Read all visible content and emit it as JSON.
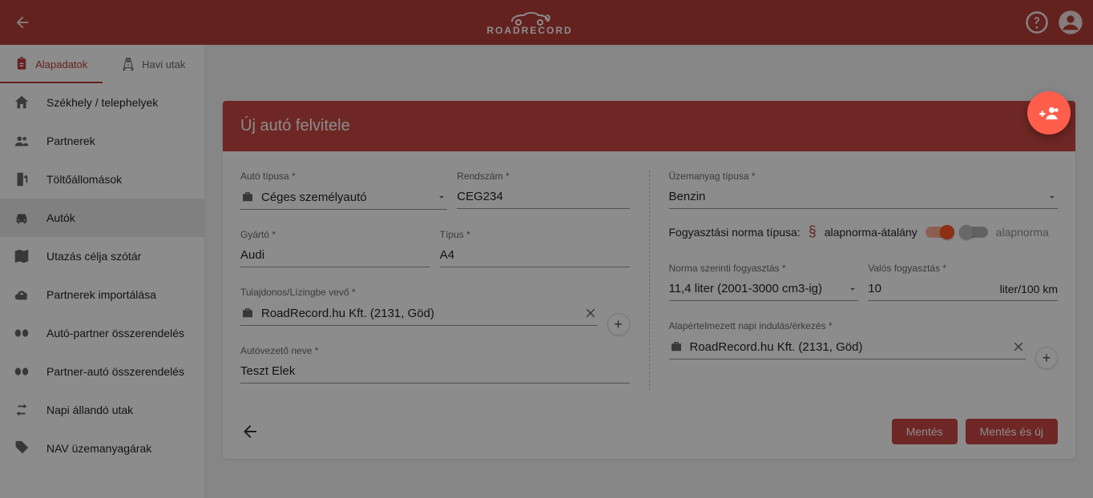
{
  "app_name": "ROADRECORD",
  "top_tabs": {
    "basic_data": "Alapadatok",
    "monthly_trips": "Havi utak"
  },
  "sidebar": {
    "items": {
      "hq": "Székhely / telephelyek",
      "partners": "Partnerek",
      "stations": "Töltőállomások",
      "cars": "Autók",
      "trip_dict": "Utazás célja szótár",
      "import_partners": "Partnerek importálása",
      "car_partner": "Autó-partner összerendelés",
      "partner_car": "Partner-autó összerendelés",
      "daily_routes": "Napi állandó utak",
      "nav_fuel": "NAV üzemanyagárak"
    }
  },
  "panel": {
    "title": "Új autó felvitele"
  },
  "fields": {
    "car_type": {
      "label": "Autó típusa *",
      "value": "Céges személyautó"
    },
    "plate": {
      "label": "Rendszám *",
      "value": "CEG234"
    },
    "maker": {
      "label": "Gyártó *",
      "value": "Audi"
    },
    "model": {
      "label": "Típus *",
      "value": "A4"
    },
    "owner": {
      "label": "Tulajdonos/Lízingbe vevő *",
      "value": "RoadRecord.hu Kft. (2131, Göd)"
    },
    "driver": {
      "label": "Autóvezető neve *",
      "value": "Teszt Elek"
    },
    "fuel": {
      "label": "Üzemanyag típusa *",
      "value": "Benzin"
    },
    "norm_type": {
      "label": "Fogyasztási norma típusa:",
      "on_label": "alapnorma-átalány",
      "off_label": "alapnorma"
    },
    "norm_consumption": {
      "label": "Norma szerinti fogyasztás *",
      "value": "11,4 liter (2001-3000 cm3-ig)"
    },
    "real_consumption": {
      "label": "Valós fogyasztás *",
      "value": "10",
      "suffix": "liter/100 km"
    },
    "default_depart": {
      "label": "Alapértelmezett napi indulás/érkezés *",
      "value": "RoadRecord.hu Kft. (2131, Göd)"
    }
  },
  "actions": {
    "save": "Mentés",
    "save_new": "Mentés és új"
  }
}
